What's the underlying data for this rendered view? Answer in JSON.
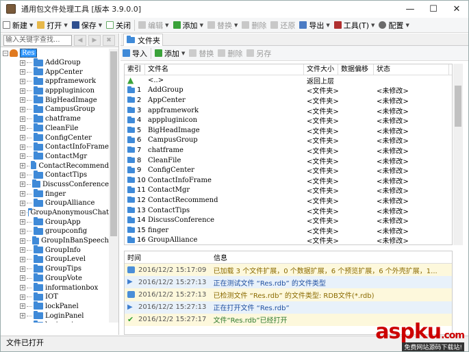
{
  "window": {
    "title": "通用包文件处理工具 [版本 3.9.0.0]",
    "minimize": "—",
    "maximize": "☐",
    "close": "✕"
  },
  "toolbar": {
    "new": "新建",
    "open": "打开",
    "save": "保存",
    "close": "关闭",
    "edit": "编辑",
    "add": "添加",
    "replace": "替换",
    "delete": "删除",
    "restore": "还原",
    "export": "导出",
    "tools": "工具(T)",
    "config": "配置"
  },
  "search": {
    "placeholder": "输入关键字查找..."
  },
  "tree": {
    "root": "Res",
    "items": [
      "AddGroup",
      "AppCenter",
      "appframework",
      "apppluginicon",
      "BigHeadImage",
      "CampusGroup",
      "chatframe",
      "CleanFile",
      "ConfigCenter",
      "ContactInfoFrame",
      "ContactMgr",
      "ContactRecommend",
      "ContactTips",
      "DiscussConference",
      "finger",
      "GroupAlliance",
      "GroupAnonymousChat",
      "GroupApp",
      "groupconfig",
      "GroupInBanSpeech",
      "GroupInfo",
      "GroupLevel",
      "GroupTips",
      "GroupVote",
      "informationbox",
      "IOT",
      "lockPanel",
      "LoginPanel",
      "logingui"
    ]
  },
  "tab": {
    "label": "文件夹"
  },
  "subtoolbar": {
    "import": "导入",
    "add": "添加",
    "replace": "替换",
    "delete": "删除",
    "saveas": "另存"
  },
  "grid": {
    "headers": {
      "index": "索引",
      "name": "文件名",
      "size": "文件大小",
      "data": "数据偏移",
      "status": "状态"
    },
    "up": {
      "name": "<..>",
      "size": "返回上层"
    },
    "rows": [
      {
        "i": "1",
        "n": "AddGroup",
        "s": "<文件夹>",
        "st": "<未修改>"
      },
      {
        "i": "2",
        "n": "AppCenter",
        "s": "<文件夹>",
        "st": "<未修改>"
      },
      {
        "i": "3",
        "n": "appframework",
        "s": "<文件夹>",
        "st": "<未修改>"
      },
      {
        "i": "4",
        "n": "apppluginicon",
        "s": "<文件夹>",
        "st": "<未修改>"
      },
      {
        "i": "5",
        "n": "BigHeadImage",
        "s": "<文件夹>",
        "st": "<未修改>"
      },
      {
        "i": "6",
        "n": "CampusGroup",
        "s": "<文件夹>",
        "st": "<未修改>"
      },
      {
        "i": "7",
        "n": "chatframe",
        "s": "<文件夹>",
        "st": "<未修改>"
      },
      {
        "i": "8",
        "n": "CleanFile",
        "s": "<文件夹>",
        "st": "<未修改>"
      },
      {
        "i": "9",
        "n": "ConfigCenter",
        "s": "<文件夹>",
        "st": "<未修改>"
      },
      {
        "i": "10",
        "n": "ContactInfoFrame",
        "s": "<文件夹>",
        "st": "<未修改>"
      },
      {
        "i": "11",
        "n": "ContactMgr",
        "s": "<文件夹>",
        "st": "<未修改>"
      },
      {
        "i": "12",
        "n": "ContactRecommend",
        "s": "<文件夹>",
        "st": "<未修改>"
      },
      {
        "i": "13",
        "n": "ContactTips",
        "s": "<文件夹>",
        "st": "<未修改>"
      },
      {
        "i": "14",
        "n": "DiscussConference",
        "s": "<文件夹>",
        "st": "<未修改>"
      },
      {
        "i": "15",
        "n": "finger",
        "s": "<文件夹>",
        "st": "<未修改>"
      },
      {
        "i": "16",
        "n": "GroupAlliance",
        "s": "<文件夹>",
        "st": "<未修改>"
      }
    ]
  },
  "log": {
    "headers": {
      "time": "时间",
      "info": "信息"
    },
    "rows": [
      {
        "icon": "message-icon",
        "color": "#fdf8dc",
        "t": "2016/12/2 15:17:09",
        "m": "已加载 3 个文件扩展，0 个数据扩展，6 个预览扩展，6 个外壳扩展，1..."
      },
      {
        "icon": "arrow-right-icon",
        "color": "#e8f1fa",
        "t": "2016/12/2 15:27:13",
        "m": "正在测试文件 “Res.rdb” 的文件类型"
      },
      {
        "icon": "message-icon",
        "color": "#fdf8dc",
        "t": "2016/12/2 15:27:13",
        "m": "已检测文件 “Res.rdb” 的文件类型: RDB文件(*.rdb)"
      },
      {
        "icon": "arrow-right-icon",
        "color": "#e8f1fa",
        "t": "2016/12/2 15:27:13",
        "m": "正在打开文件 “Res.rdb”"
      },
      {
        "icon": "check-icon",
        "color": "#fdf8dc",
        "t": "2016/12/2 15:27:17",
        "m": "文件“Res.rdb”已经打开"
      }
    ]
  },
  "status": {
    "text": "文件已打开"
  },
  "watermark": {
    "brand": "aspku",
    "suffix": ".com",
    "tagline": "免费网站源码下载站!"
  }
}
